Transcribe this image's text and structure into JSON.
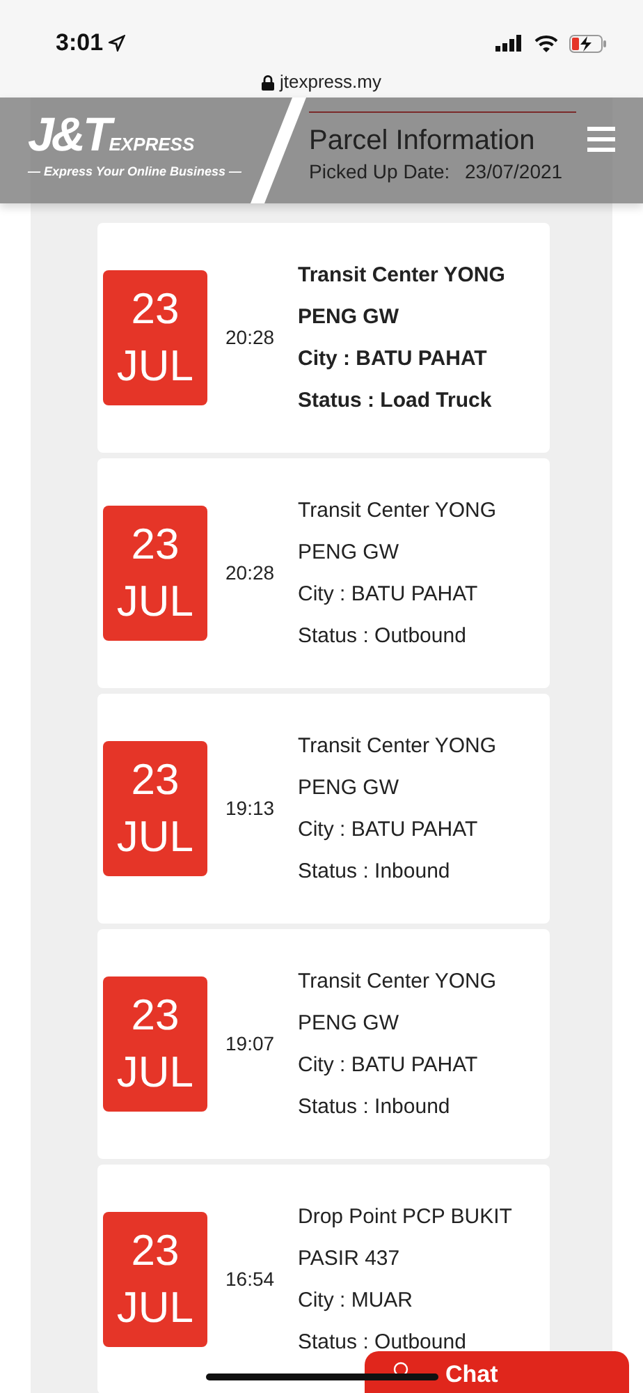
{
  "status_bar": {
    "time": "3:01"
  },
  "browser": {
    "url": "jtexpress.my"
  },
  "header": {
    "logo": "J&T",
    "logo_sub": "EXPRESS",
    "tagline": "— Express Your Online Business —"
  },
  "parcel": {
    "title": "Parcel Information",
    "picked_label": "Picked Up Date:",
    "picked_value": "23/07/2021"
  },
  "events": [
    {
      "day": "23",
      "month": "JUL",
      "time": "20:28",
      "location": "Transit Center YONG PENG GW",
      "city": "City : BATU PAHAT",
      "status": "Status : Load Truck",
      "latest": true
    },
    {
      "day": "23",
      "month": "JUL",
      "time": "20:28",
      "location": "Transit Center YONG PENG GW",
      "city": "City : BATU PAHAT",
      "status": "Status : Outbound",
      "latest": false
    },
    {
      "day": "23",
      "month": "JUL",
      "time": "19:13",
      "location": "Transit Center YONG PENG GW",
      "city": "City : BATU PAHAT",
      "status": "Status : Inbound",
      "latest": false
    },
    {
      "day": "23",
      "month": "JUL",
      "time": "19:07",
      "location": "Transit Center YONG PENG GW",
      "city": "City : BATU PAHAT",
      "status": "Status : Inbound",
      "latest": false
    },
    {
      "day": "23",
      "month": "JUL",
      "time": "16:54",
      "location": "Drop Point PCP BUKIT PASIR 437",
      "city": "City : MUAR",
      "status": "Status : Outbound",
      "latest": false
    }
  ],
  "chat": {
    "label": "Chat"
  }
}
